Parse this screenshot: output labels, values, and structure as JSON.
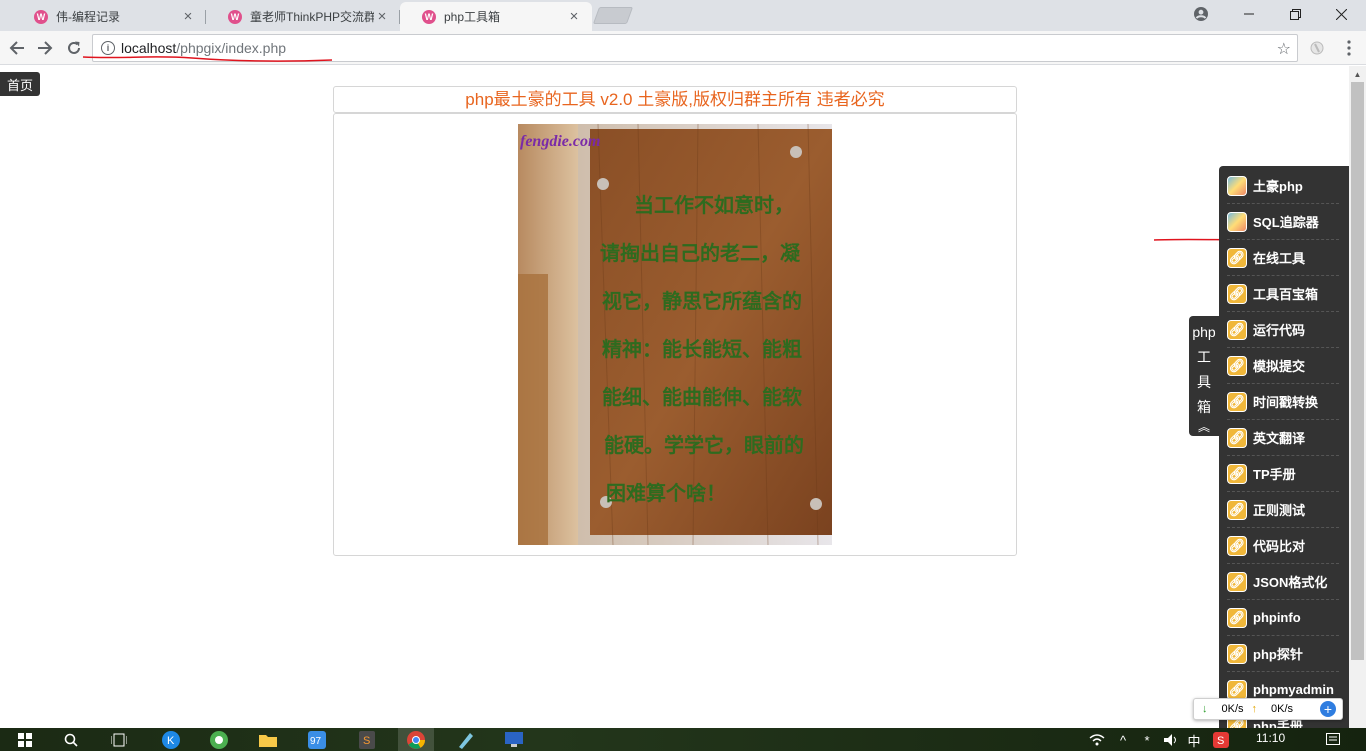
{
  "browser": {
    "tabs": [
      {
        "title": "伟-编程记录",
        "active": false
      },
      {
        "title": "童老师ThinkPHP交流群",
        "active": false
      },
      {
        "title": "php工具箱",
        "active": true
      }
    ],
    "url_host": "localhost",
    "url_path": "/phpgix/index.php"
  },
  "page": {
    "home_label": "首页",
    "headline": "php最土豪的工具 v2.0 土豪版,版权归群主所有 违者必究",
    "photo": {
      "watermark": "fengdie.com",
      "sign_lines": [
        "当工作不如意时，",
        "请掏出自己的老二，凝",
        "视它，静思它所蕴含的",
        "精神：能长能短、能粗",
        "能细、能曲能伸、能软",
        "能硬。学学它，眼前的",
        "困难算个啥！"
      ]
    }
  },
  "toolbox": {
    "tab_label_top": "php",
    "tab_label_chars": [
      "工",
      "具",
      "箱"
    ],
    "items": [
      {
        "label": "土豪php",
        "icon": "image-icon"
      },
      {
        "label": "SQL追踪器",
        "icon": "image-icon"
      },
      {
        "label": "在线工具",
        "icon": "link-icon"
      },
      {
        "label": "工具百宝箱",
        "icon": "link-icon"
      },
      {
        "label": "运行代码",
        "icon": "link-icon"
      },
      {
        "label": "模拟提交",
        "icon": "link-icon"
      },
      {
        "label": "时间戳转换",
        "icon": "link-icon"
      },
      {
        "label": "英文翻译",
        "icon": "link-icon"
      },
      {
        "label": "TP手册",
        "icon": "link-icon"
      },
      {
        "label": "正则测试",
        "icon": "link-icon"
      },
      {
        "label": "代码比对",
        "icon": "link-icon"
      },
      {
        "label": "JSON格式化",
        "icon": "link-icon"
      },
      {
        "label": "phpinfo",
        "icon": "link-icon"
      },
      {
        "label": "php探针",
        "icon": "link-icon"
      },
      {
        "label": "phpmyadmin",
        "icon": "link-icon"
      },
      {
        "label": "php手册",
        "icon": "link-icon"
      }
    ]
  },
  "netspeed": {
    "down": "0K/s",
    "up": "0K/s"
  },
  "taskbar": {
    "clock": "11:10",
    "ime": "中"
  },
  "colors": {
    "headline": "#e8651f",
    "annotation": "#e0141e",
    "sidebar": "#333333"
  }
}
